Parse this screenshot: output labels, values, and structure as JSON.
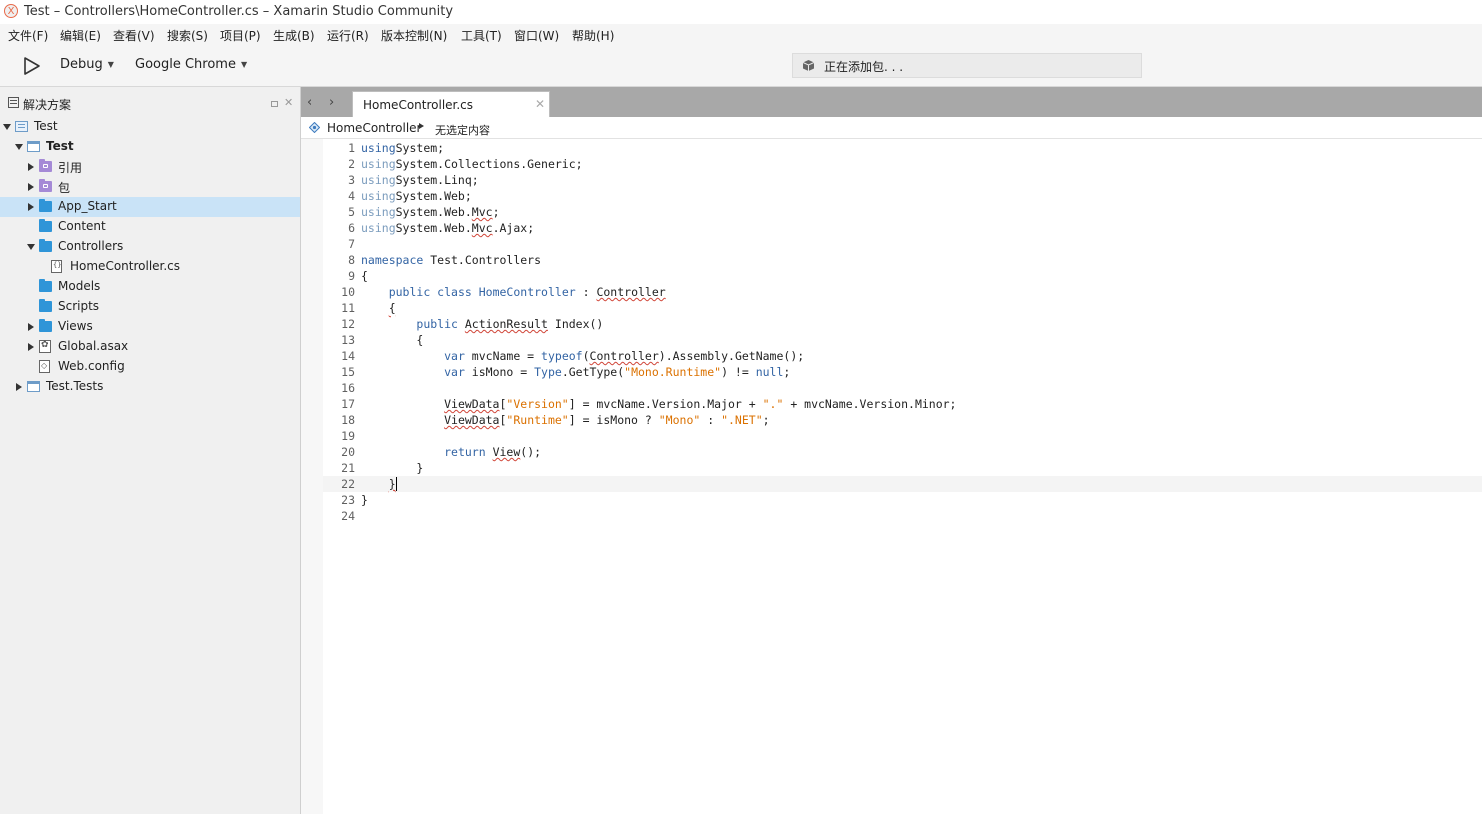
{
  "window": {
    "title": "Test – Controllers\\HomeController.cs – Xamarin Studio Community",
    "logo_glyph": "X"
  },
  "menu": [
    "文件(F)",
    "编辑(E)",
    "查看(V)",
    "搜索(S)",
    "项目(P)",
    "生成(B)",
    "运行(R)",
    "版本控制(N)",
    "工具(T)",
    "窗口(W)",
    "帮助(H)"
  ],
  "toolbar": {
    "configuration": "Debug",
    "target": "Google Chrome",
    "status": "正在添加包. . ."
  },
  "solution_pad": {
    "title": "解决方案",
    "close_glyph": "✕",
    "items": [
      {
        "label": "Test",
        "depth": 0,
        "icon": "solution-icon",
        "expander": "expanded",
        "bold": false,
        "selected": false
      },
      {
        "label": "Test",
        "depth": 1,
        "icon": "project-icon",
        "expander": "expanded",
        "bold": true,
        "selected": false
      },
      {
        "label": "引用",
        "depth": 2,
        "icon": "references-folder-icon",
        "expander": "collapsed",
        "bold": false,
        "selected": false
      },
      {
        "label": "包",
        "depth": 2,
        "icon": "packages-folder-icon",
        "expander": "collapsed",
        "bold": false,
        "selected": false
      },
      {
        "label": "App_Start",
        "depth": 2,
        "icon": "folder-icon",
        "expander": "collapsed",
        "bold": false,
        "selected": true
      },
      {
        "label": "Content",
        "depth": 2,
        "icon": "folder-icon",
        "expander": "none",
        "bold": false,
        "selected": false
      },
      {
        "label": "Controllers",
        "depth": 2,
        "icon": "folder-icon",
        "expander": "expanded",
        "bold": false,
        "selected": false
      },
      {
        "label": "HomeController.cs",
        "depth": 3,
        "icon": "csharp-file-icon",
        "expander": "none",
        "bold": false,
        "selected": false
      },
      {
        "label": "Models",
        "depth": 2,
        "icon": "folder-icon",
        "expander": "none",
        "bold": false,
        "selected": false
      },
      {
        "label": "Scripts",
        "depth": 2,
        "icon": "folder-icon",
        "expander": "none",
        "bold": false,
        "selected": false
      },
      {
        "label": "Views",
        "depth": 2,
        "icon": "folder-icon",
        "expander": "collapsed",
        "bold": false,
        "selected": false
      },
      {
        "label": "Global.asax",
        "depth": 2,
        "icon": "asax-file-icon",
        "expander": "collapsed",
        "bold": false,
        "selected": false
      },
      {
        "label": "Web.config",
        "depth": 2,
        "icon": "config-file-icon",
        "expander": "none",
        "bold": false,
        "selected": false
      },
      {
        "label": "Test.Tests",
        "depth": 1,
        "icon": "project-icon",
        "expander": "collapsed",
        "bold": false,
        "selected": false
      }
    ]
  },
  "editor": {
    "tab": {
      "label": "HomeController.cs",
      "close_glyph": "✕"
    },
    "nav": {
      "back_glyph": "‹",
      "forward_glyph": "›"
    },
    "pathbar": {
      "class_name": "HomeController",
      "member": "无选定内容"
    },
    "current_line": 22,
    "lines": [
      {
        "n": "1",
        "segs": [
          [
            "kw",
            "using"
          ],
          [
            "",
            "System;"
          ]
        ]
      },
      {
        "n": "2",
        "segs": [
          [
            "dim",
            "using"
          ],
          [
            "",
            "System.Collections.Generic;"
          ]
        ]
      },
      {
        "n": "3",
        "segs": [
          [
            "dim",
            "using"
          ],
          [
            "",
            "System.Linq;"
          ]
        ]
      },
      {
        "n": "4",
        "segs": [
          [
            "dim",
            "using"
          ],
          [
            "",
            "System.Web;"
          ]
        ]
      },
      {
        "n": "5",
        "segs": [
          [
            "dim",
            "using"
          ],
          [
            "",
            "System.Web."
          ],
          [
            "sq",
            "Mvc"
          ],
          [
            "",
            ";"
          ]
        ]
      },
      {
        "n": "6",
        "segs": [
          [
            "dim",
            "using"
          ],
          [
            "",
            "System.Web."
          ],
          [
            "sq",
            "Mvc"
          ],
          [
            "",
            ".Ajax;"
          ]
        ]
      },
      {
        "n": "7",
        "segs": []
      },
      {
        "n": "8",
        "segs": [
          [
            "kw",
            "namespace"
          ],
          [
            "",
            " Test.Controllers"
          ]
        ]
      },
      {
        "n": "9",
        "segs": [
          [
            "",
            "{"
          ]
        ]
      },
      {
        "n": "10",
        "segs": [
          [
            "",
            "    "
          ],
          [
            "kw",
            "public class"
          ],
          [
            "",
            " "
          ],
          [
            "typ",
            "HomeController"
          ],
          [
            "",
            " : "
          ],
          [
            "sq",
            "Controller"
          ]
        ]
      },
      {
        "n": "11",
        "segs": [
          [
            "",
            "    "
          ],
          [
            "sq",
            "{"
          ]
        ]
      },
      {
        "n": "12",
        "segs": [
          [
            "",
            "        "
          ],
          [
            "kw",
            "public"
          ],
          [
            "",
            " "
          ],
          [
            "sq",
            "ActionResult"
          ],
          [
            "",
            " Index()"
          ]
        ]
      },
      {
        "n": "13",
        "segs": [
          [
            "",
            "        {"
          ]
        ]
      },
      {
        "n": "14",
        "segs": [
          [
            "",
            "            "
          ],
          [
            "kw",
            "var"
          ],
          [
            "",
            " mvcName = "
          ],
          [
            "kw",
            "typeof"
          ],
          [
            "",
            "("
          ],
          [
            "sq",
            "Controller"
          ],
          [
            "",
            ").Assembly.GetName();"
          ]
        ]
      },
      {
        "n": "15",
        "segs": [
          [
            "",
            "            "
          ],
          [
            "kw",
            "var"
          ],
          [
            "",
            " isMono = "
          ],
          [
            "typ",
            "Type"
          ],
          [
            "",
            ".GetType("
          ],
          [
            "str",
            "\"Mono.Runtime\""
          ],
          [
            "",
            ") != "
          ],
          [
            "kw",
            "null"
          ],
          [
            "",
            ";"
          ]
        ]
      },
      {
        "n": "16",
        "segs": []
      },
      {
        "n": "17",
        "segs": [
          [
            "",
            "            "
          ],
          [
            "sq",
            "ViewData"
          ],
          [
            "",
            "["
          ],
          [
            "str",
            "\"Version\""
          ],
          [
            "",
            "] = mvcName.Version.Major + "
          ],
          [
            "str",
            "\".\""
          ],
          [
            "",
            " + mvcName.Version.Minor;"
          ]
        ]
      },
      {
        "n": "18",
        "segs": [
          [
            "",
            "            "
          ],
          [
            "sq",
            "ViewData"
          ],
          [
            "",
            "["
          ],
          [
            "str",
            "\"Runtime\""
          ],
          [
            "",
            "] = isMono ? "
          ],
          [
            "str",
            "\"Mono\""
          ],
          [
            "",
            " : "
          ],
          [
            "str",
            "\".NET\""
          ],
          [
            "",
            ";"
          ]
        ]
      },
      {
        "n": "19",
        "segs": []
      },
      {
        "n": "20",
        "segs": [
          [
            "",
            "            "
          ],
          [
            "kw",
            "return"
          ],
          [
            "",
            " "
          ],
          [
            "sq",
            "View"
          ],
          [
            "",
            "();"
          ]
        ]
      },
      {
        "n": "21",
        "segs": [
          [
            "",
            "        }"
          ]
        ]
      },
      {
        "n": "22",
        "segs": [
          [
            "",
            "    "
          ],
          [
            "sq",
            "}"
          ],
          [
            "caret",
            ""
          ]
        ]
      },
      {
        "n": "23",
        "segs": [
          [
            "",
            "}"
          ]
        ]
      },
      {
        "n": "24",
        "segs": []
      }
    ]
  },
  "colors": {
    "keyword": "#3364a4",
    "string": "#db7100",
    "selection": "#c9e3f7",
    "folder": "#2f95d8",
    "tabbar": "#a8a8a8"
  }
}
